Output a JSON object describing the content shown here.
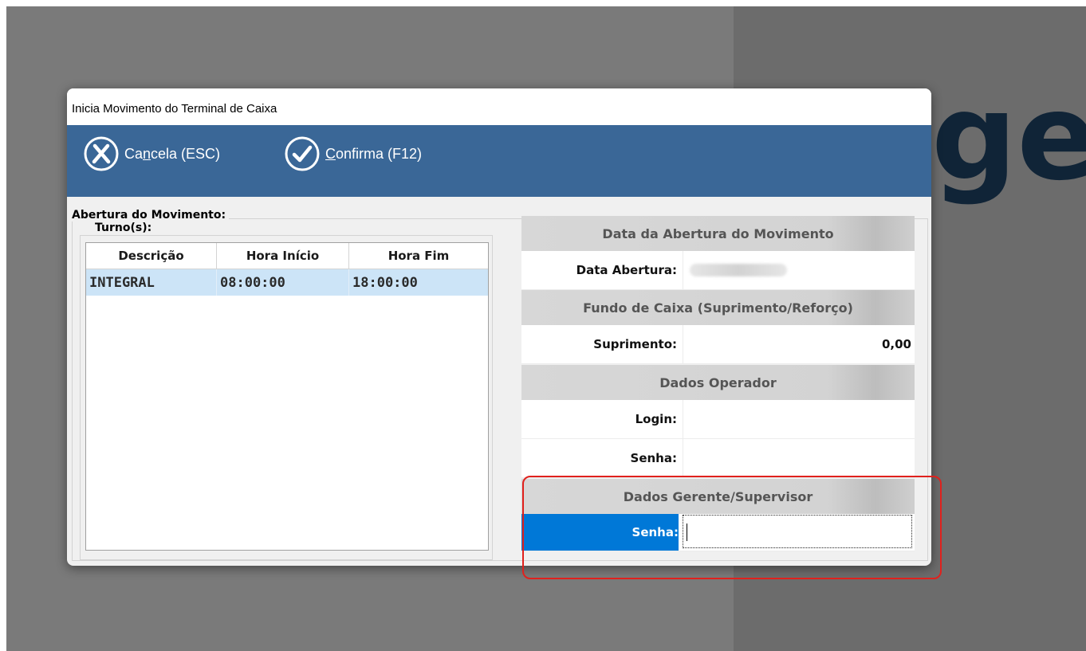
{
  "background": {
    "logo_text": "ge"
  },
  "dialog": {
    "title": "Inicia Movimento do Terminal de Caixa",
    "toolbar": {
      "cancel": {
        "pre": "Ca",
        "hotkey": "n",
        "post": "cela (ESC)",
        "icon": "cancel-circle-x-icon"
      },
      "confirm": {
        "pre": "",
        "hotkey": "C",
        "post": "onfirma (F12)",
        "icon": "confirm-circle-check-icon"
      }
    },
    "group_title": "Abertura do Movimento:",
    "turnos": {
      "title": "Turno(s):",
      "columns": [
        "Descrição",
        "Hora Início",
        "Hora Fim"
      ],
      "rows": [
        [
          "INTEGRAL",
          "08:00:00",
          "18:00:00"
        ]
      ]
    },
    "panel": {
      "data_abertura_header": "Data da Abertura do Movimento",
      "data_abertura_label": "Data Abertura:",
      "fundo_header": "Fundo de Caixa (Suprimento/Reforço)",
      "suprimento_label": "Suprimento:",
      "suprimento_value": "0,00",
      "operador_header": "Dados Operador",
      "login_label": "Login:",
      "login_value": "",
      "senha_label": "Senha:",
      "senha_value": "",
      "gerente_header": "Dados Gerente/Supervisor",
      "gerente_senha_label": "Senha:",
      "gerente_senha_value": ""
    },
    "colors": {
      "toolbar": "#3a6797",
      "selection": "#cce4f7",
      "active_label": "#0078d7",
      "highlight": "#e0211d"
    }
  }
}
